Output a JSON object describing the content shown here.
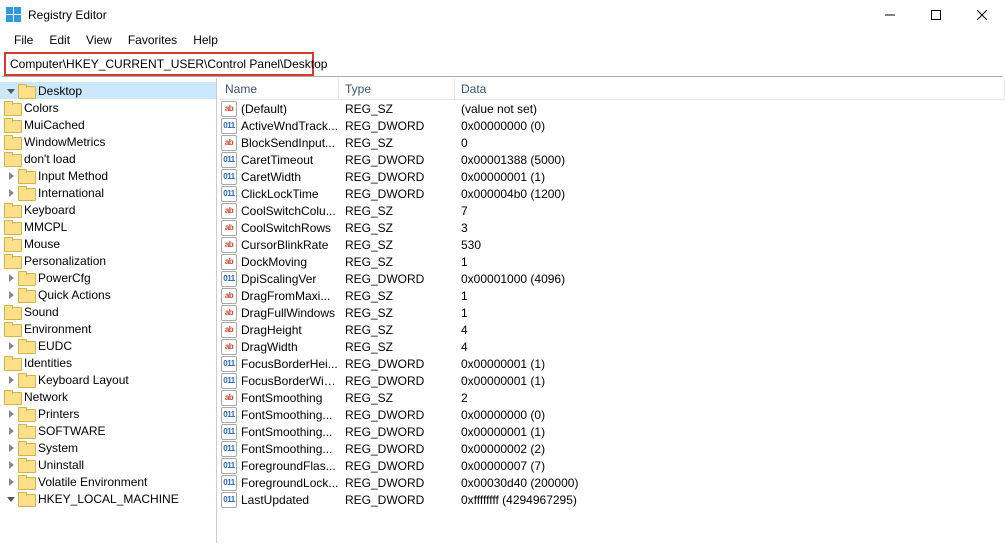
{
  "window": {
    "title": "Registry Editor",
    "controls": {
      "min": "minimize-icon",
      "max": "maximize-icon",
      "close": "close-icon"
    }
  },
  "menubar": [
    "File",
    "Edit",
    "View",
    "Favorites",
    "Help"
  ],
  "addressbar": {
    "value": "Computer\\HKEY_CURRENT_USER\\Control Panel\\Desktop"
  },
  "tree": {
    "selected": "Desktop",
    "items": [
      {
        "label": "Desktop",
        "depth": "twisty-2",
        "twisty": "open",
        "selected": true
      },
      {
        "label": "Colors",
        "depth": "3"
      },
      {
        "label": "MuiCached",
        "depth": "3"
      },
      {
        "label": "WindowMetrics",
        "depth": "3"
      },
      {
        "label": "don't load",
        "depth": "2"
      },
      {
        "label": "Input Method",
        "depth": "twisty-2",
        "twisty": "closed"
      },
      {
        "label": "International",
        "depth": "twisty-2",
        "twisty": "closed"
      },
      {
        "label": "Keyboard",
        "depth": "2"
      },
      {
        "label": "MMCPL",
        "depth": "2"
      },
      {
        "label": "Mouse",
        "depth": "2"
      },
      {
        "label": "Personalization",
        "depth": "2"
      },
      {
        "label": "PowerCfg",
        "depth": "twisty-2",
        "twisty": "closed"
      },
      {
        "label": "Quick Actions",
        "depth": "twisty-2",
        "twisty": "closed"
      },
      {
        "label": "Sound",
        "depth": "2"
      },
      {
        "label": "Environment",
        "depth": "1"
      },
      {
        "label": "EUDC",
        "depth": "twisty-1",
        "twisty": "closed"
      },
      {
        "label": "Identities",
        "depth": "1"
      },
      {
        "label": "Keyboard Layout",
        "depth": "twisty-1",
        "twisty": "closed"
      },
      {
        "label": "Network",
        "depth": "1"
      },
      {
        "label": "Printers",
        "depth": "twisty-1",
        "twisty": "closed"
      },
      {
        "label": "SOFTWARE",
        "depth": "twisty-1",
        "twisty": "closed"
      },
      {
        "label": "System",
        "depth": "twisty-1",
        "twisty": "closed"
      },
      {
        "label": "Uninstall",
        "depth": "twisty-1",
        "twisty": "closed"
      },
      {
        "label": "Volatile Environment",
        "depth": "twisty-1",
        "twisty": "closed"
      },
      {
        "label": "HKEY_LOCAL_MACHINE",
        "depth": "twisty-0",
        "twisty": "open"
      }
    ]
  },
  "list": {
    "columns": {
      "name": "Name",
      "type": "Type",
      "data": "Data"
    },
    "rows": [
      {
        "icon": "sz",
        "name": "(Default)",
        "type": "REG_SZ",
        "data": "(value not set)"
      },
      {
        "icon": "dw",
        "name": "ActiveWndTrack...",
        "type": "REG_DWORD",
        "data": "0x00000000 (0)"
      },
      {
        "icon": "sz",
        "name": "BlockSendInput...",
        "type": "REG_SZ",
        "data": "0"
      },
      {
        "icon": "dw",
        "name": "CaretTimeout",
        "type": "REG_DWORD",
        "data": "0x00001388 (5000)"
      },
      {
        "icon": "dw",
        "name": "CaretWidth",
        "type": "REG_DWORD",
        "data": "0x00000001 (1)"
      },
      {
        "icon": "dw",
        "name": "ClickLockTime",
        "type": "REG_DWORD",
        "data": "0x000004b0 (1200)"
      },
      {
        "icon": "sz",
        "name": "CoolSwitchColu...",
        "type": "REG_SZ",
        "data": "7"
      },
      {
        "icon": "sz",
        "name": "CoolSwitchRows",
        "type": "REG_SZ",
        "data": "3"
      },
      {
        "icon": "sz",
        "name": "CursorBlinkRate",
        "type": "REG_SZ",
        "data": "530"
      },
      {
        "icon": "sz",
        "name": "DockMoving",
        "type": "REG_SZ",
        "data": "1"
      },
      {
        "icon": "dw",
        "name": "DpiScalingVer",
        "type": "REG_DWORD",
        "data": "0x00001000 (4096)"
      },
      {
        "icon": "sz",
        "name": "DragFromMaxi...",
        "type": "REG_SZ",
        "data": "1"
      },
      {
        "icon": "sz",
        "name": "DragFullWindows",
        "type": "REG_SZ",
        "data": "1"
      },
      {
        "icon": "sz",
        "name": "DragHeight",
        "type": "REG_SZ",
        "data": "4"
      },
      {
        "icon": "sz",
        "name": "DragWidth",
        "type": "REG_SZ",
        "data": "4"
      },
      {
        "icon": "dw",
        "name": "FocusBorderHei...",
        "type": "REG_DWORD",
        "data": "0x00000001 (1)"
      },
      {
        "icon": "dw",
        "name": "FocusBorderWid...",
        "type": "REG_DWORD",
        "data": "0x00000001 (1)"
      },
      {
        "icon": "sz",
        "name": "FontSmoothing",
        "type": "REG_SZ",
        "data": "2"
      },
      {
        "icon": "dw",
        "name": "FontSmoothing...",
        "type": "REG_DWORD",
        "data": "0x00000000 (0)"
      },
      {
        "icon": "dw",
        "name": "FontSmoothing...",
        "type": "REG_DWORD",
        "data": "0x00000001 (1)"
      },
      {
        "icon": "dw",
        "name": "FontSmoothing...",
        "type": "REG_DWORD",
        "data": "0x00000002 (2)"
      },
      {
        "icon": "dw",
        "name": "ForegroundFlas...",
        "type": "REG_DWORD",
        "data": "0x00000007 (7)"
      },
      {
        "icon": "dw",
        "name": "ForegroundLock...",
        "type": "REG_DWORD",
        "data": "0x00030d40 (200000)"
      },
      {
        "icon": "dw",
        "name": "LastUpdated",
        "type": "REG_DWORD",
        "data": "0xffffffff (4294967295)"
      }
    ]
  }
}
